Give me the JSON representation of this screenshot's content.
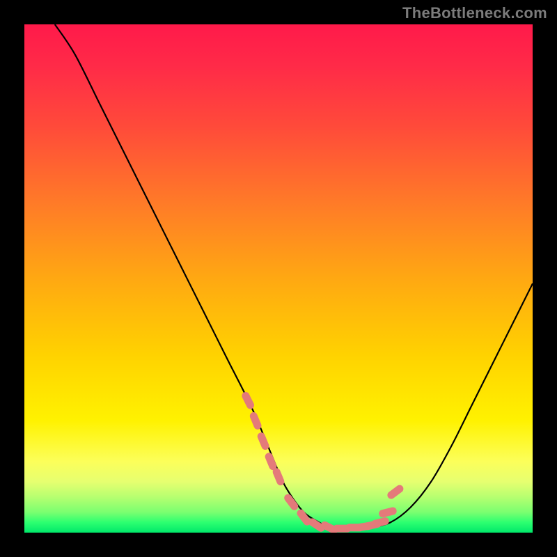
{
  "watermark": "TheBottleneck.com",
  "colors": {
    "page_bg": "#000000",
    "gradient_top": "#ff1a4a",
    "gradient_mid": "#ffd200",
    "gradient_bottom": "#00e86a",
    "curve": "#000000",
    "marker": "#e47a7a"
  },
  "chart_data": {
    "type": "line",
    "title": "",
    "xlabel": "",
    "ylabel": "",
    "xlim": [
      0,
      100
    ],
    "ylim": [
      0,
      100
    ],
    "grid": false,
    "series": [
      {
        "name": "curve",
        "x": [
          6,
          10,
          15,
          20,
          25,
          30,
          35,
          40,
          45,
          50,
          52,
          55,
          58,
          60,
          62,
          65,
          68,
          72,
          76,
          80,
          84,
          88,
          92,
          96,
          100
        ],
        "y": [
          100,
          94,
          84,
          74,
          64,
          54,
          44,
          34,
          24,
          12,
          8,
          4,
          2,
          1,
          0.5,
          0.5,
          1,
          2,
          5,
          10,
          17,
          25,
          33,
          41,
          49
        ]
      }
    ],
    "markers": {
      "name": "highlight",
      "x": [
        44,
        45.5,
        47,
        48.5,
        50,
        52.5,
        55,
        57.5,
        60,
        62.5,
        65,
        67,
        68.5,
        70,
        71.5,
        73
      ],
      "y": [
        26,
        22,
        18,
        14,
        11,
        6,
        3,
        1.5,
        1,
        0.8,
        1,
        1.2,
        1.5,
        2,
        4,
        8
      ]
    },
    "annotations": []
  }
}
